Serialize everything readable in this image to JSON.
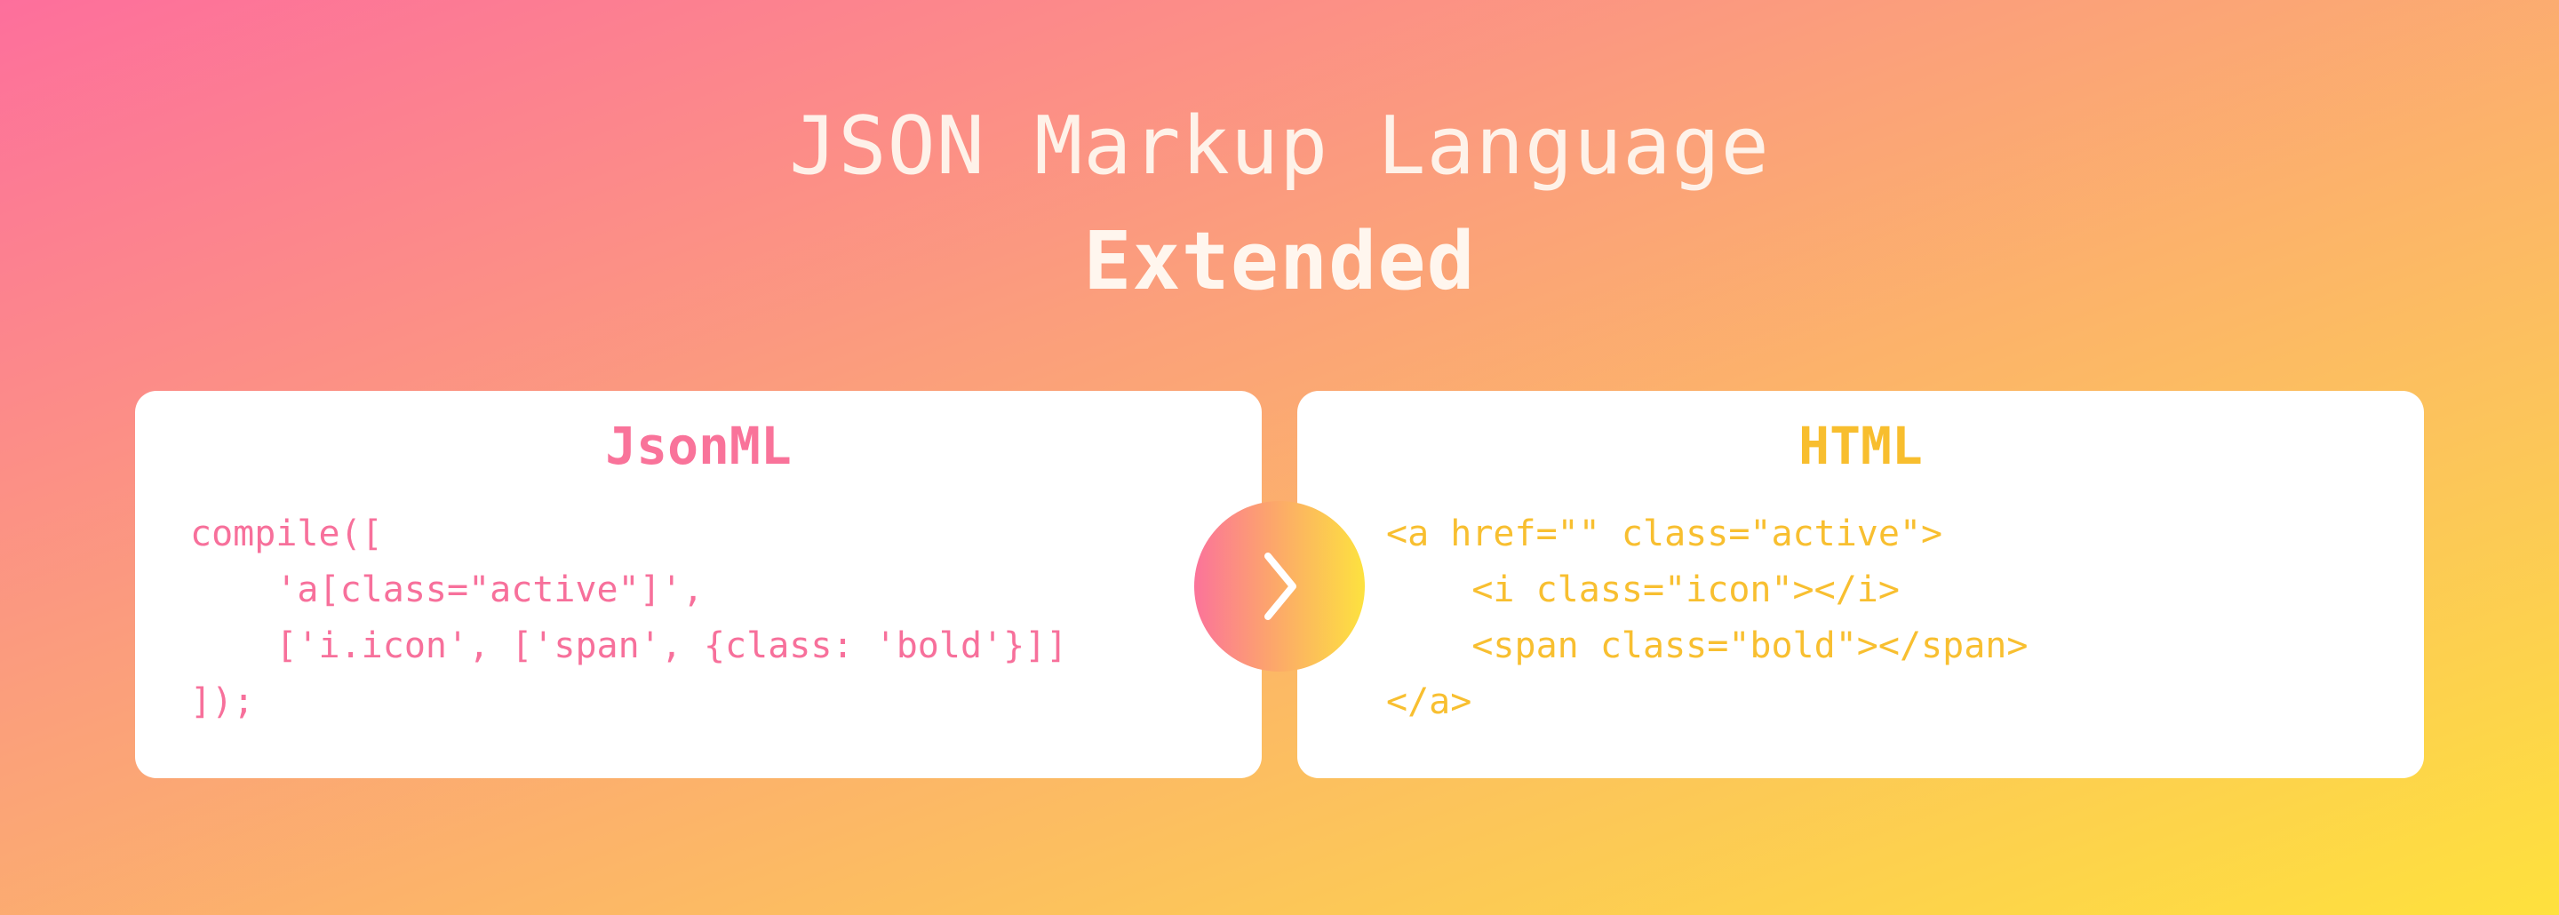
{
  "header": {
    "title": "JSON Markup Language",
    "subtitle": "Extended"
  },
  "panels": {
    "left": {
      "title": "JsonML",
      "code_lines": [
        "compile([",
        "    'a[class=\"active\"]',",
        "    ['i.icon', ['span', {class: 'bold'}]]",
        "]);"
      ]
    },
    "right": {
      "title": "HTML",
      "code_lines": [
        "<a href=\"\" class=\"active\">",
        "    <i class=\"icon\"></i>",
        "    <span class=\"bold\"></span>",
        "</a>"
      ]
    }
  },
  "controls": {
    "arrow_icon": "chevron-right-icon"
  },
  "colors": {
    "jsonml_accent": "#f7709b",
    "html_accent": "#f8bf30",
    "gradient_start": "#fd6f9c",
    "gradient_end": "#fee13d"
  }
}
